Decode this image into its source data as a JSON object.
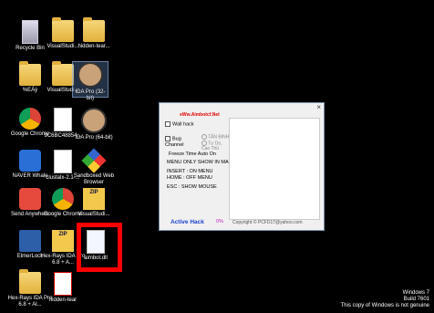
{
  "desktop": {
    "icons": [
      {
        "label": "Recycle Bin"
      },
      {
        "label": "VisualStudi..."
      },
      {
        "label": "hidden-tear..."
      },
      {
        "label": "%EÁý"
      },
      {
        "label": "VisualStudi..."
      },
      {
        "label": "IDA Pro (32-bit)"
      },
      {
        "label": "Google Chrome"
      },
      {
        "label": "9C6BC48854..."
      },
      {
        "label": "IDA Pro (64-bit)"
      },
      {
        "label": "NAVER Whale"
      },
      {
        "label": "clustalx-2.1-..."
      },
      {
        "label": "Sandboxed Web Browser"
      },
      {
        "label": "Send Anywhere"
      },
      {
        "label": "Google Chrome"
      },
      {
        "label": "VisualStudi..."
      },
      {
        "label": "ElmerLock"
      },
      {
        "label": "Hex-Rays IDA Pro 6.8 + A..."
      },
      {
        "label": "aimbot.dll"
      },
      {
        "label": "Hex-Rays IDA Pro 6.8 + Al..."
      },
      {
        "label": "hidden-tear"
      }
    ]
  },
  "dialog": {
    "close_label": "×",
    "site": "eWw.Aimbotcf.Net",
    "wallhack": "Wall hack",
    "bug_channel": "Bug Channel",
    "tan_binh": "TÂN BINH",
    "tu_do": "Tự Do, Cao Thủ",
    "freeze": "Freeze Time Auto On",
    "menu_only": "MENU ONLY SHOW IN MAP",
    "insert": "INSERT : ON MENU",
    "home": "HOME : OFF MENU",
    "esc": "ESC : SHOW MOUSE",
    "active_hack": "Active Hack",
    "percent": "0%",
    "copyright": "Copyright © PCFD17@yahoo.com"
  },
  "watermark": {
    "line1": "Windows 7",
    "line2": "Build 7601",
    "line3": "This copy of Windows is not genuine"
  }
}
